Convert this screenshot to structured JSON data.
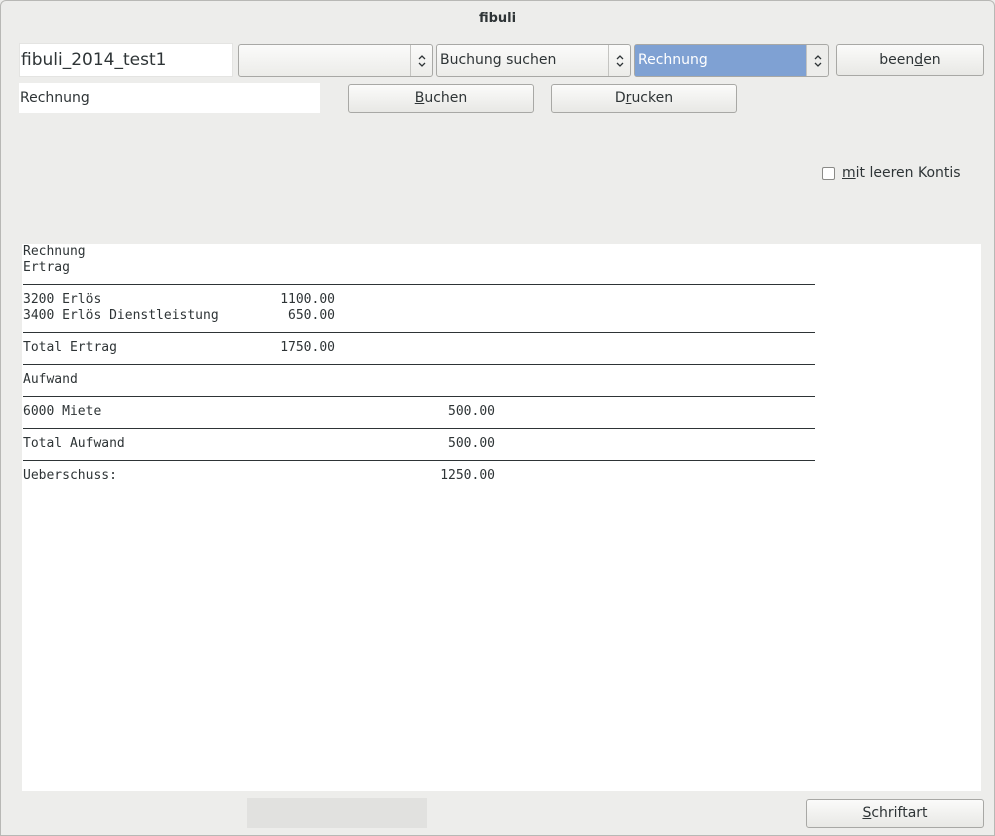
{
  "window": {
    "title": "fibuli"
  },
  "toolbar": {
    "file_name": "fibuli_2014_test1",
    "combo_empty": "",
    "combo_search": "Buchung suchen",
    "combo_report": "Rechnung",
    "quit_label_pre": "been",
    "quit_label_mn": "d",
    "quit_label_post": "en"
  },
  "row2": {
    "report_label": "Rechnung",
    "book_mn": "B",
    "book_rest": "uchen",
    "print_pre": "D",
    "print_mn": "r",
    "print_post": "ucken"
  },
  "options": {
    "empty_accounts_mn": "m",
    "empty_accounts_rest": "it leeren Kontis",
    "empty_accounts_checked": false
  },
  "report": {
    "title": "Rechnung",
    "income_header": "Ertrag",
    "income_rows": [
      {
        "account": "3200 Erlös",
        "amount": "1100.00"
      },
      {
        "account": "3400 Erlös Dienstleistung",
        "amount": "650.00"
      }
    ],
    "income_total_label": "Total Ertrag",
    "income_total": "1750.00",
    "expense_header": "Aufwand",
    "expense_rows": [
      {
        "account": "6000 Miete",
        "amount": "500.00"
      }
    ],
    "expense_total_label": "Total Aufwand",
    "expense_total": "500.00",
    "surplus_label": "Ueberschuss:",
    "surplus": "1250.00"
  },
  "footer": {
    "font_mn": "S",
    "font_rest": "chriftart"
  },
  "icons": {
    "combo_arrow": "updown-chevron-icon"
  }
}
